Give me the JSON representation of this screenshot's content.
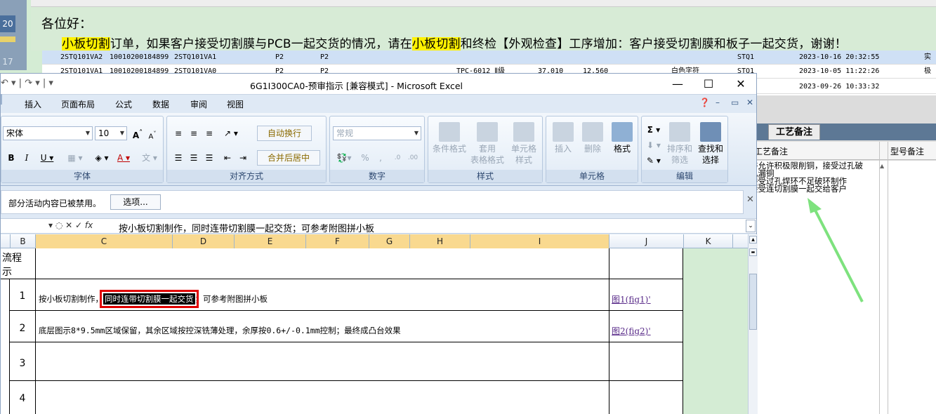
{
  "background": {
    "row_numbers": [
      "20",
      "17"
    ],
    "greeting": "各位好：",
    "message_parts": [
      {
        "text": "小板切割",
        "highlight": true
      },
      {
        "text": "订单，如果客户接受切割膜与PCB一起交货的情况，请在",
        "highlight": false
      },
      {
        "text": "小板切割",
        "highlight": true
      },
      {
        "text": "和终检【外观检查】工序增加：客户接受切割膜和板子一起交货，谢谢！",
        "highlight": false
      }
    ],
    "rows": [
      [
        "2STQ101VA2",
        "10010200184899",
        "2STQ101VA1",
        "P2",
        "P2",
        "",
        "",
        "",
        "STQ1",
        "2023-10-16 20:32:55",
        "实"
      ],
      [
        "2STQ101VA1",
        "10010200184899",
        "2STQ101VA0",
        "P2",
        "P2",
        "TPC-6012 Ⅱ级",
        "37.010",
        "12.560",
        "白色字符",
        "STQ1",
        "2023-10-05 11:22:26",
        "极"
      ],
      [
        "",
        "",
        "",
        "",
        "",
        "",
        "",
        "",
        "",
        "",
        "2023-09-26 10:33:32",
        ""
      ]
    ]
  },
  "right_panel": {
    "tab": "工艺备注",
    "col1": "工艺备注",
    "col2": "型号备注",
    "note_lines": [
      "许允许积极限削铜，接受过孔破",
      "孔漏铜",
      "接受过孔焊环不足破环制作",
      "接受连切割膜一起交给客户"
    ]
  },
  "excel": {
    "window_title": "6G1I300CA0-预审指示  [兼容模式] - Microsoft Excel",
    "window_buttons": {
      "minimize": "—",
      "maximize": "☐",
      "close": "✕"
    },
    "tabs": [
      "插入",
      "页面布局",
      "公式",
      "数据",
      "审阅",
      "视图"
    ],
    "ribbon": {
      "font_name": "宋体",
      "font_size": "10",
      "number_format": "常规",
      "wrap_text": "自动换行",
      "merge_center": "合并后居中",
      "percent": "%",
      "comma": ",",
      "groups": [
        "字体",
        "对齐方式",
        "数字",
        "样式",
        "单元格",
        "编辑"
      ],
      "style_buttons": [
        "条件格式",
        "套用\n表格格式",
        "单元格\n样式"
      ],
      "cell_buttons": [
        "插入",
        "删除",
        "格式"
      ],
      "edit_buttons": [
        "排序和\n筛选",
        "查找和\n选择"
      ]
    },
    "security_bar": {
      "text": "部分活动内容已被禁用。",
      "button": "选项..."
    },
    "formula_bar": {
      "fx": "fx",
      "content": "按小板切割制作，同时连带切割膜一起交货；可参考附图拼小板"
    },
    "columns": [
      "B",
      "C",
      "D",
      "E",
      "F",
      "G",
      "H",
      "I",
      "J",
      "K"
    ],
    "sheet": {
      "header_lines": [
        "流程",
        "示"
      ],
      "rows": [
        {
          "num": "1",
          "text_before": "按小板切割制作，",
          "selected": "同时连带切割膜一起交货",
          "text_after": "；可参考附图拼小板",
          "link": "图1(fig1)'"
        },
        {
          "num": "2",
          "text_before": "底层图示8*9.5mm区域保留，其余区域按控深铣薄处理，余厚按0.6+/-0.1mm控制；最终成凸台效果",
          "selected": "",
          "text_after": "",
          "link": "图2(fig2)'"
        },
        {
          "num": "3",
          "text_before": "",
          "selected": "",
          "text_after": "",
          "link": ""
        },
        {
          "num": "4",
          "text_before": "",
          "selected": "",
          "text_after": "",
          "link": ""
        }
      ]
    }
  },
  "colors": {
    "highlight": "#fff200",
    "selection_outline": "#e00000",
    "link": "#5a2c8a",
    "selected_column_header": "#f9d98f"
  }
}
